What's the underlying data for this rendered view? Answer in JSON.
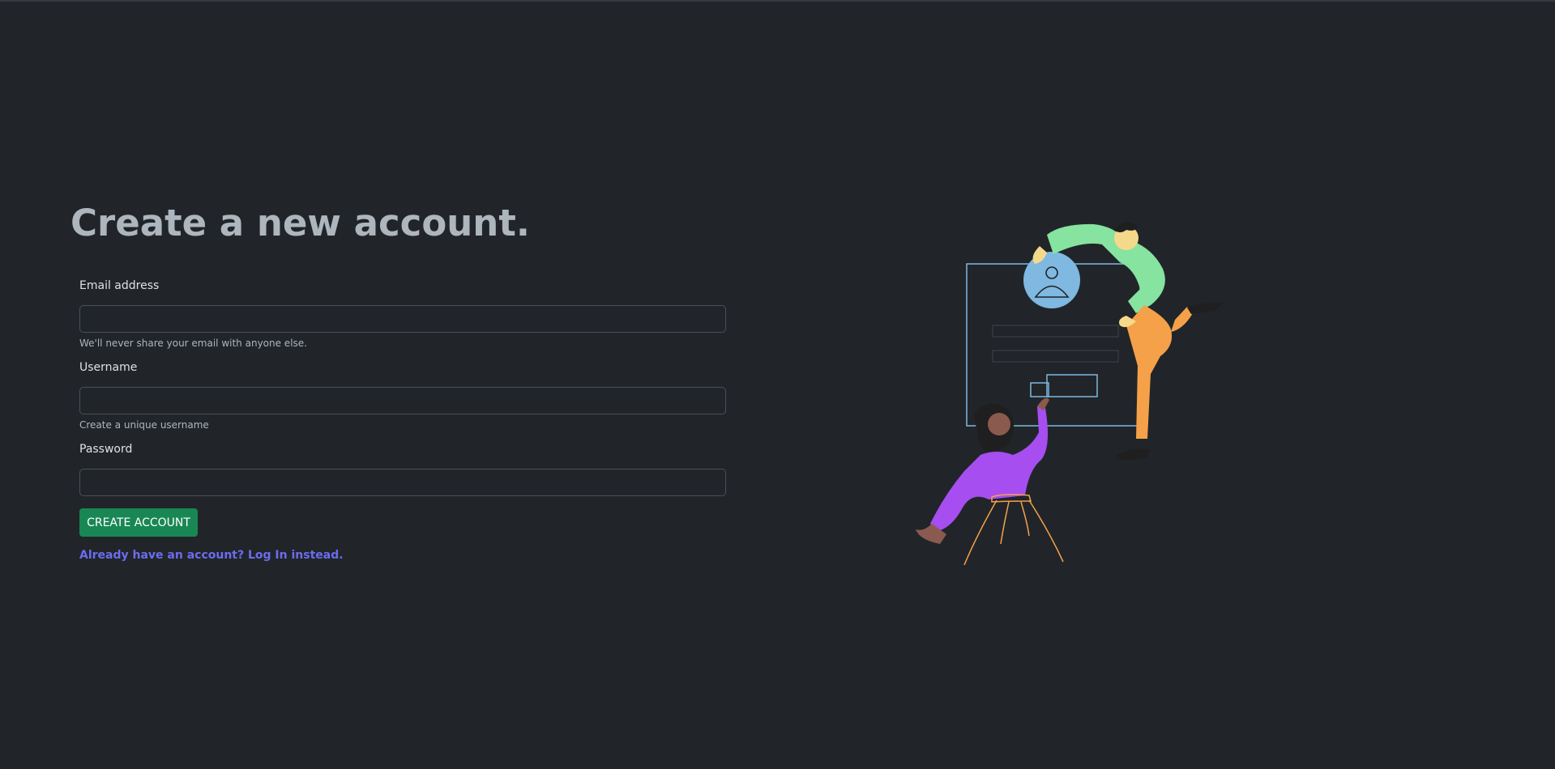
{
  "page": {
    "title": "Create a new account."
  },
  "form": {
    "email": {
      "label": "Email address",
      "value": "",
      "help": "We'll never share your email with anyone else."
    },
    "username": {
      "label": "Username",
      "value": "",
      "help": "Create a unique username"
    },
    "password": {
      "label": "Password",
      "value": ""
    },
    "submit_label": "CREATE ACCOUNT",
    "login_link": "Already have an account? Log In instead."
  },
  "colors": {
    "background": "#212529",
    "submit": "#198754",
    "link": "#6c6cf0"
  },
  "illustration": {
    "icon": "signup-people-illustration"
  }
}
